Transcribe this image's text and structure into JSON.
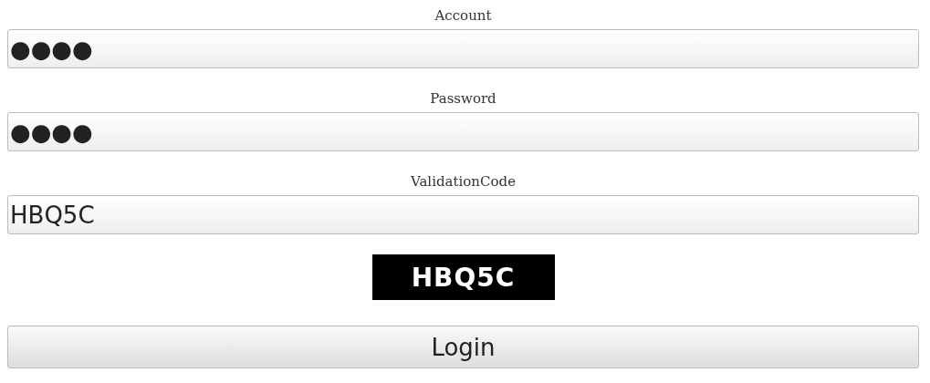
{
  "fields": [
    {
      "label": "Account",
      "value": "●●●●"
    },
    {
      "label": "Password",
      "value": "●●●●"
    },
    {
      "label": "ValidationCode",
      "value": "HBQ5C"
    }
  ],
  "captcha": {
    "text": "HBQ5C"
  },
  "button": {
    "label": "Login"
  }
}
